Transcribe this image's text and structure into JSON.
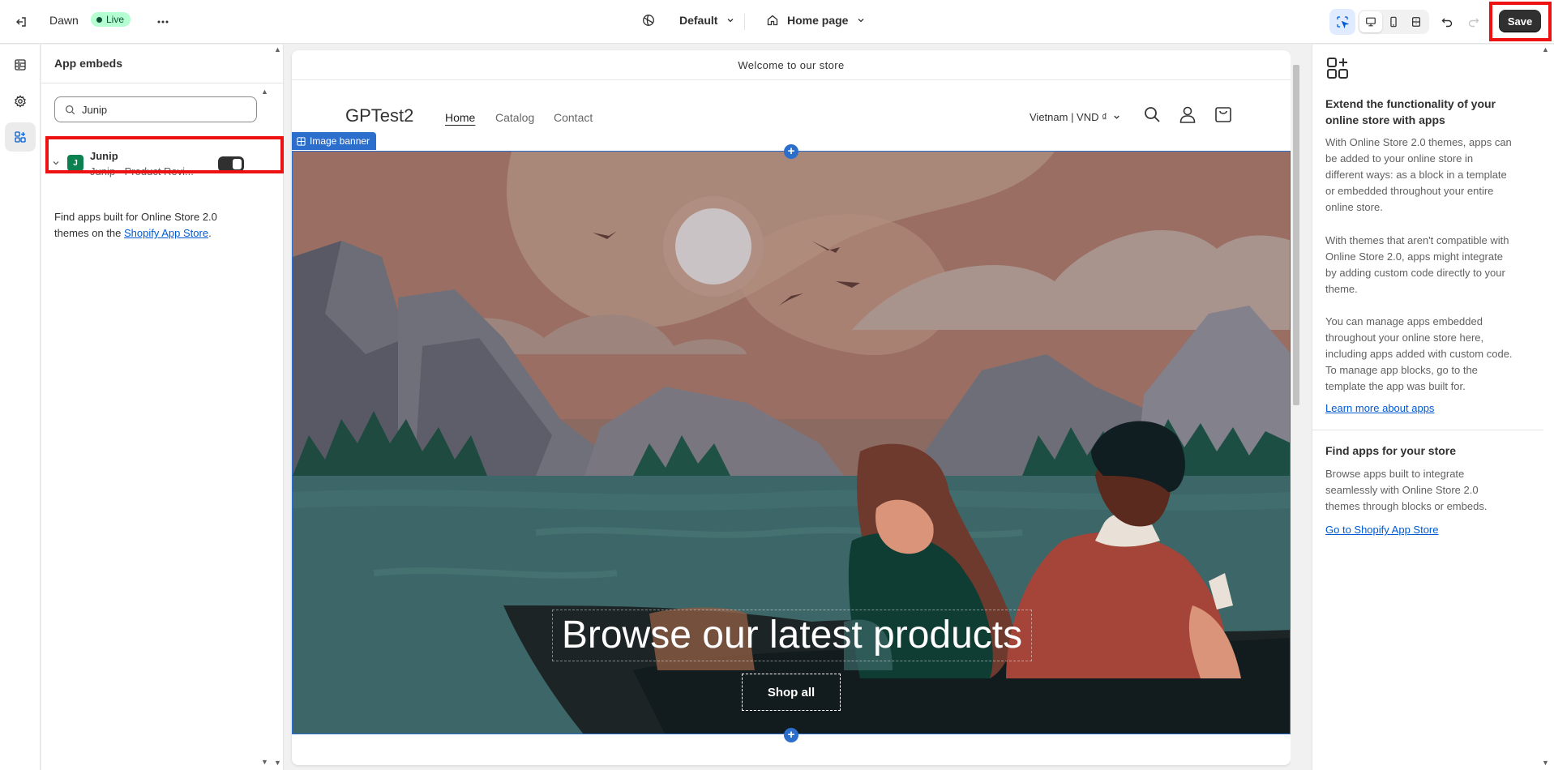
{
  "topbar": {
    "theme_name": "Dawn",
    "live_label": "Live",
    "theme_select": "Default",
    "page_select": "Home page",
    "save_label": "Save",
    "icons": [
      "exit-icon",
      "more-icon",
      "globe-icon",
      "home-icon",
      "inspector-icon",
      "desktop-icon",
      "mobile-icon",
      "fullwidth-icon",
      "undo-icon",
      "redo-icon"
    ]
  },
  "sidebar_rail": {
    "items": [
      {
        "icon": "sections-icon"
      },
      {
        "icon": "settings-icon"
      },
      {
        "icon": "apps-icon",
        "active": true
      }
    ]
  },
  "app_embeds": {
    "title": "App embeds",
    "search_value": "Junip",
    "apps": [
      {
        "logo": "J",
        "name": "Junip",
        "description": "Junip - Product Revi...",
        "enabled": true
      }
    ],
    "help_prefix": "Find apps built for Online Store 2.0 themes on the ",
    "help_link": "Shopify App Store",
    "help_suffix": "."
  },
  "preview": {
    "announcement": "Welcome to our store",
    "store_name": "GPTest2",
    "nav": [
      "Home",
      "Catalog",
      "Contact"
    ],
    "currency": "Vietnam | VND ₫",
    "section_tag": "Image banner",
    "hero_title": "Browse our latest products",
    "hero_button": "Shop all"
  },
  "info_panel": {
    "heading1": "Extend the functionality of your online store with apps",
    "para1": "With Online Store 2.0 themes, apps can be added to your online store in different ways: as a block in a template or embedded throughout your entire online store.",
    "para2": "With themes that aren't compatible with Online Store 2.0, apps might integrate by adding custom code directly to your theme.",
    "para3": "You can manage apps embedded throughout your online store here, including apps added with custom code. To manage app blocks, go to the template the app was built for.",
    "link1": "Learn more about apps",
    "heading2": "Find apps for your store",
    "para4": "Browse apps built to integrate seamlessly with Online Store 2.0 themes through blocks or embeds.",
    "link2": "Go to Shopify App Store"
  },
  "colors": {
    "accent": "#2c6ecb",
    "live_bg": "#b4fed2",
    "primary_button": "#303030",
    "highlight": "#ee1111"
  }
}
